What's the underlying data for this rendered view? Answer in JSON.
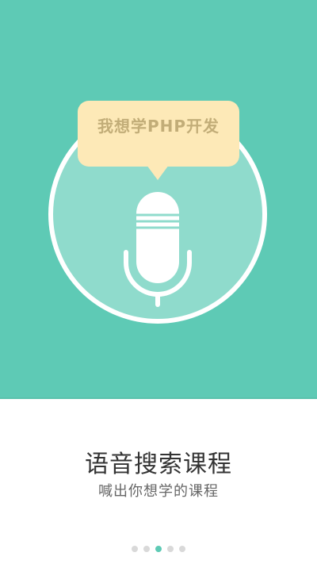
{
  "hero": {
    "bubble_text": "我想学PHP开发",
    "colors": {
      "background": "#5ecab5",
      "circle_fill": "#8fdbcc",
      "outline": "#ffffff",
      "bubble": "#fde9b7",
      "bubble_text": "#c2ad78"
    }
  },
  "content": {
    "title": "语音搜索课程",
    "subtitle": "喊出你想学的课程"
  },
  "pager": {
    "total_pages": 5,
    "current_page": 3
  },
  "icons": {
    "microphone": "microphone-icon",
    "speech_bubble": "speech-bubble-icon"
  }
}
